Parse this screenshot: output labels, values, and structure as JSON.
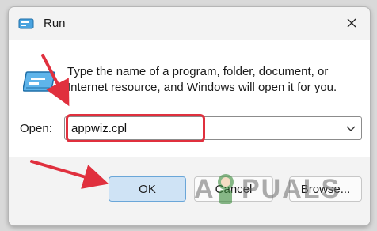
{
  "window": {
    "title": "Run",
    "close_label": "✕"
  },
  "body": {
    "description": "Type the name of a program, folder, document, or Internet resource, and Windows will open it for you.",
    "open_label": "Open:",
    "open_value": "appwiz.cpl"
  },
  "footer": {
    "ok_label": "OK",
    "cancel_label": "Cancel",
    "browse_label": "Browse..."
  },
  "watermark": {
    "text": "APPUALS"
  },
  "colors": {
    "highlight": "#e0303e",
    "primary_button": "#cfe3f5",
    "icon_blue": "#3a9ad9"
  },
  "icons": {
    "title": "run-icon",
    "body": "run-icon",
    "close": "close-icon",
    "combo": "chevron-down-icon"
  }
}
